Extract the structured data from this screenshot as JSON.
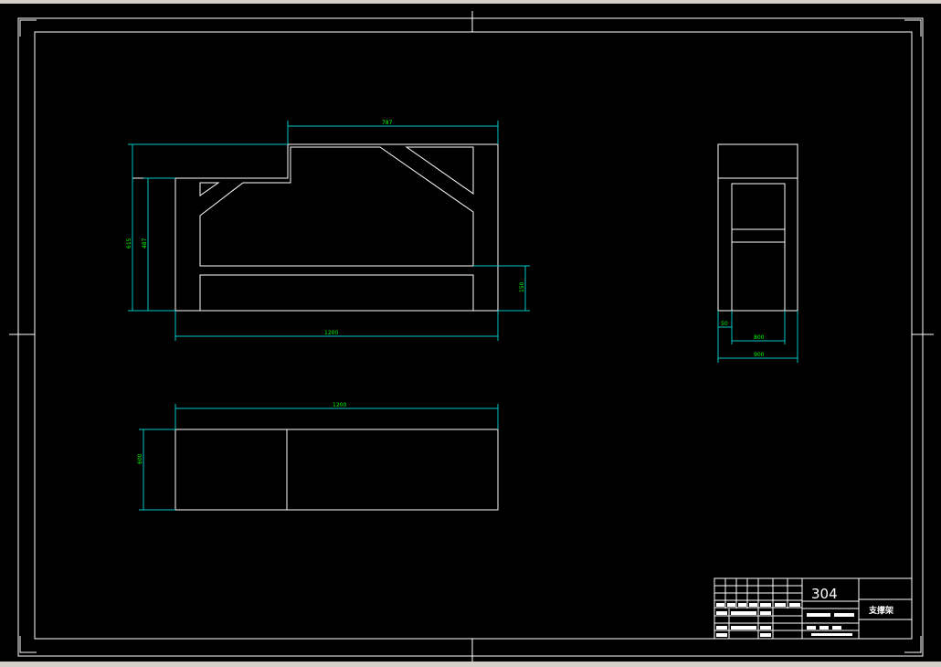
{
  "drawing": {
    "dimensions": {
      "top_width": "787",
      "front_height_total": "615",
      "front_height_inner": "487",
      "front_bottom_band": "150",
      "front_length": "1200",
      "plan_length": "1200",
      "plan_width": "600",
      "side_wall": "50",
      "side_inner": "800",
      "side_outer": "900"
    },
    "title_block": {
      "drawing_number": "304",
      "part_name": "支撑架"
    }
  },
  "colors": {
    "background": "#000000",
    "geometry": "#ffffff",
    "dimension_lines": "#00c8c8",
    "dimension_text": "#00ff00"
  }
}
